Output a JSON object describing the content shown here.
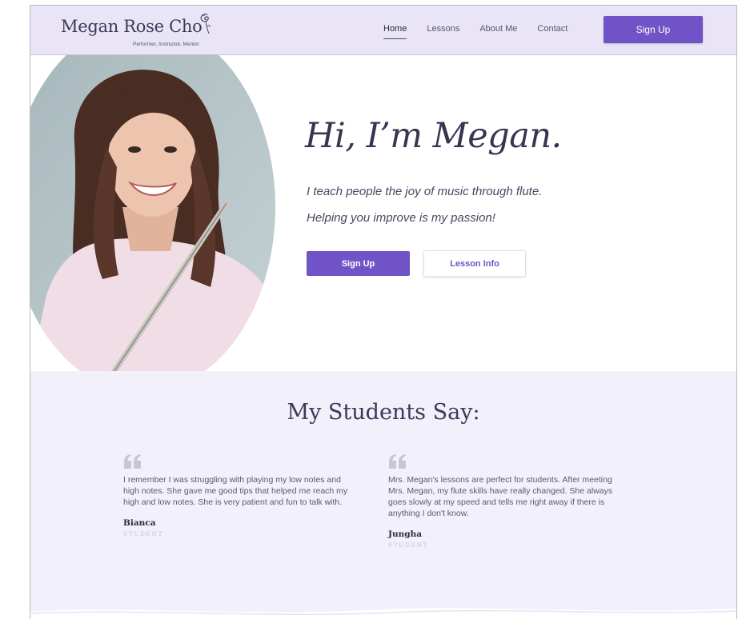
{
  "brand": {
    "name": "Megan Rose Cho",
    "subtitle": "Performer, Instructor, Mentor"
  },
  "nav": {
    "items": [
      {
        "label": "Home",
        "active": true
      },
      {
        "label": "Lessons",
        "active": false
      },
      {
        "label": "About Me",
        "active": false
      },
      {
        "label": "Contact",
        "active": false
      }
    ],
    "signup_label": "Sign Up"
  },
  "hero": {
    "greeting": "Hi, I’m Megan.",
    "tagline_1": "I teach people the joy of music through flute.",
    "tagline_2": "Helping you improve is my passion!",
    "signup_label": "Sign Up",
    "lesson_info_label": "Lesson Info"
  },
  "testimonials": {
    "title": "My Students Say:",
    "items": [
      {
        "text": "I remember I was struggling with playing my low notes and high notes. She gave me good tips that helped me reach my high and low notes. She is very patient and fun to talk with.",
        "author": "Bianca",
        "role": "STUDENT"
      },
      {
        "text": "Mrs. Megan's lessons are perfect for students. After meeting Mrs. Megan, my flute skills have really changed. She always goes slowly at my speed and tells me right away if there is anything I don't know.",
        "author": "Jungha",
        "role": "STUDENT"
      }
    ]
  },
  "colors": {
    "accent": "#7053c6",
    "header_bg": "#e9e5f7",
    "section_bg": "#f2f0fb",
    "heading": "#3a3452"
  },
  "icons": [
    "rose-icon",
    "quote-icon"
  ]
}
